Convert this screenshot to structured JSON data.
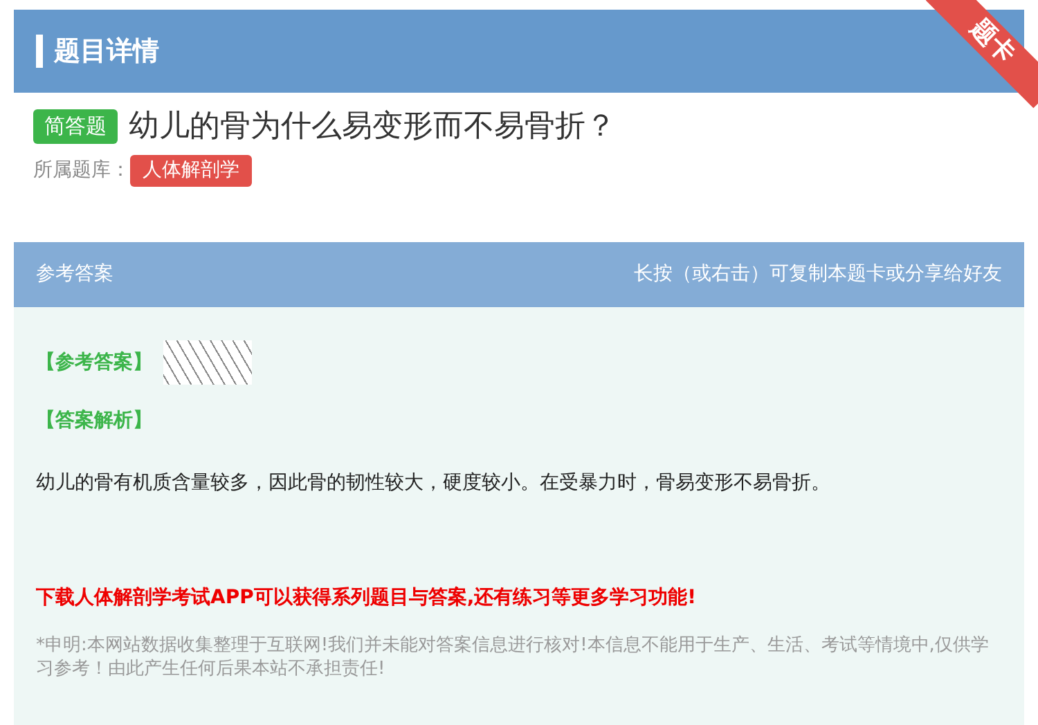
{
  "header": {
    "title": "题目详情",
    "ribbon": "题卡"
  },
  "question": {
    "type_badge": "简答题",
    "text": "幼儿的骨为什么易变形而不易骨折？",
    "bank_label": "所属题库：",
    "bank": "人体解剖学"
  },
  "answer_panel": {
    "title": "参考答案",
    "hint": "长按（或右击）可复制本题卡或分享给好友",
    "answer_label": "【参考答案】",
    "analysis_label": "【答案解析】",
    "analysis": "幼儿的骨有机质含量较多，因此骨的韧性较大，硬度较小。在受暴力时，骨易变形不易骨折。",
    "promo": "下载人体解剖学考试APP可以获得系列题目与答案,还有练习等更多学习功能!",
    "disclaimer": "*申明:本网站数据收集整理于互联网!我们并未能对答案信息进行核对!本信息不能用于生产、生活、考试等情境中,仅供学习参考！由此产生任何后果本站不承担责任!"
  }
}
